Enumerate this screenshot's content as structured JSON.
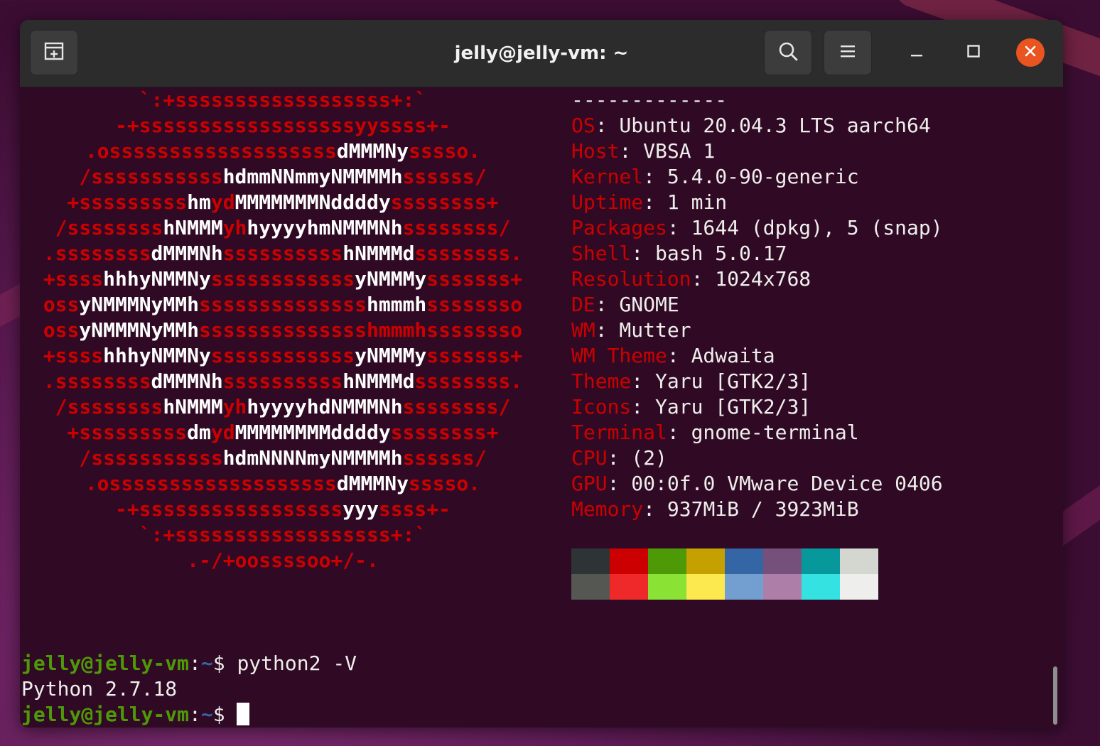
{
  "window": {
    "title": "jelly@jelly-vm: ~"
  },
  "titlebar": {
    "new_tab_icon": "new-tab-icon",
    "search_icon": "search-icon",
    "menu_icon": "hamburger-menu-icon",
    "minimize_icon": "minimize-icon",
    "maximize_icon": "maximize-icon",
    "close_icon": "close-icon"
  },
  "logo_lines": [
    [
      [
        "r",
        "`:+ssssssssssssssssss+:`"
      ]
    ],
    [
      [
        "r",
        "-+ssssssssssssssssssyyssss+-"
      ]
    ],
    [
      [
        "r",
        ".osssssssssssssssssss"
      ],
      [
        "w",
        "dMMMNy"
      ],
      [
        "r",
        "sssso."
      ]
    ],
    [
      [
        "r",
        "/sssssssssss"
      ],
      [
        "w",
        "hdmmNNmmyNMMMMh"
      ],
      [
        "r",
        "ssssss/"
      ]
    ],
    [
      [
        "r",
        "+sssssssss"
      ],
      [
        "w",
        "hm"
      ],
      [
        "r",
        "yd"
      ],
      [
        "w",
        "MMMMMMMNddddy"
      ],
      [
        "r",
        "ssssssss+"
      ]
    ],
    [
      [
        "r",
        "/ssssssss"
      ],
      [
        "w",
        "hNMMM"
      ],
      [
        "r",
        "yh"
      ],
      [
        "w",
        "hyyyyhmNMMMNh"
      ],
      [
        "r",
        "ssssssss/"
      ]
    ],
    [
      [
        "r",
        ".ssssssss"
      ],
      [
        "w",
        "dMMMNh"
      ],
      [
        "r",
        "ssssssssss"
      ],
      [
        "w",
        "hNMMMd"
      ],
      [
        "r",
        "ssssssss."
      ]
    ],
    [
      [
        "r",
        "+ssss"
      ],
      [
        "w",
        "hhhyNMMNy"
      ],
      [
        "r",
        "ssssssssssss"
      ],
      [
        "w",
        "yNMMMy"
      ],
      [
        "r",
        "sssssss+"
      ]
    ],
    [
      [
        "r",
        "oss"
      ],
      [
        "w",
        "yNMMMNyMMh"
      ],
      [
        "r",
        "ssssssssssssss"
      ],
      [
        "w",
        "hmmmh"
      ],
      [
        "r",
        "ssssssso"
      ]
    ],
    [
      [
        "r",
        "oss"
      ],
      [
        "w",
        "yNMMMNyMMh"
      ],
      [
        "r",
        "sssssssssssssshmmmhssssssso"
      ]
    ],
    [
      [
        "r",
        "+ssss"
      ],
      [
        "w",
        "hhhyNMMNy"
      ],
      [
        "r",
        "ssssssssssss"
      ],
      [
        "w",
        "yNMMMy"
      ],
      [
        "r",
        "sssssss+"
      ]
    ],
    [
      [
        "r",
        ".ssssssss"
      ],
      [
        "w",
        "dMMMNh"
      ],
      [
        "r",
        "ssssssssss"
      ],
      [
        "w",
        "hNMMMd"
      ],
      [
        "r",
        "ssssssss."
      ]
    ],
    [
      [
        "r",
        "/ssssssss"
      ],
      [
        "w",
        "hNMMM"
      ],
      [
        "r",
        "yh"
      ],
      [
        "w",
        "hyyyyhdNMMMNh"
      ],
      [
        "r",
        "ssssssss/"
      ]
    ],
    [
      [
        "r",
        "+sssssssss"
      ],
      [
        "w",
        "dm"
      ],
      [
        "r",
        "yd"
      ],
      [
        "w",
        "MMMMMMMMddddy"
      ],
      [
        "r",
        "ssssssss+"
      ]
    ],
    [
      [
        "r",
        "/sssssssssss"
      ],
      [
        "w",
        "hdmNNNNmyNMMMMh"
      ],
      [
        "r",
        "ssssss/"
      ]
    ],
    [
      [
        "r",
        ".osssssssssssssssssss"
      ],
      [
        "w",
        "dMMMNy"
      ],
      [
        "r",
        "sssso."
      ]
    ],
    [
      [
        "r",
        "-+sssssssssssssssss"
      ],
      [
        "w",
        "yyy"
      ],
      [
        "r",
        "ssss+-"
      ]
    ],
    [
      [
        "r",
        "`:+ssssssssssssssssss+:`"
      ]
    ],
    [
      [
        "r",
        ".-/+oossssoo+/-."
      ]
    ]
  ],
  "sysinfo": {
    "separator": "-------------",
    "rows": [
      {
        "key": "OS",
        "value": ": Ubuntu 20.04.3 LTS aarch64"
      },
      {
        "key": "Host",
        "value": ": VBSA 1"
      },
      {
        "key": "Kernel",
        "value": ": 5.4.0-90-generic"
      },
      {
        "key": "Uptime",
        "value": ": 1 min"
      },
      {
        "key": "Packages",
        "value": ": 1644 (dpkg), 5 (snap)"
      },
      {
        "key": "Shell",
        "value": ": bash 5.0.17"
      },
      {
        "key": "Resolution",
        "value": ": 1024x768"
      },
      {
        "key": "DE",
        "value": ": GNOME"
      },
      {
        "key": "WM",
        "value": ": Mutter"
      },
      {
        "key": "WM Theme",
        "value": ": Adwaita"
      },
      {
        "key": "Theme",
        "value": ": Yaru [GTK2/3]"
      },
      {
        "key": "Icons",
        "value": ": Yaru [GTK2/3]"
      },
      {
        "key": "Terminal",
        "value": ": gnome-terminal"
      },
      {
        "key": "CPU",
        "value": ": (2)"
      },
      {
        "key": "GPU",
        "value": ": 00:0f.0 VMware Device 0406"
      },
      {
        "key": "Memory",
        "value": ": 937MiB / 3923MiB"
      }
    ]
  },
  "palette": {
    "normal": [
      "#2e3436",
      "#cc0000",
      "#4e9a06",
      "#c4a000",
      "#3465a4",
      "#75507b",
      "#06989a",
      "#d3d7cf"
    ],
    "bright": [
      "#555753",
      "#ef2929",
      "#8ae234",
      "#fce94f",
      "#729fcf",
      "#ad7fa8",
      "#34e2e2",
      "#eeeeec"
    ]
  },
  "shell": {
    "user_host": "jelly@jelly-vm",
    "colon": ":",
    "path": "~",
    "dollar": "$ ",
    "command1": "python2 -V",
    "output1": "Python 2.7.18"
  }
}
